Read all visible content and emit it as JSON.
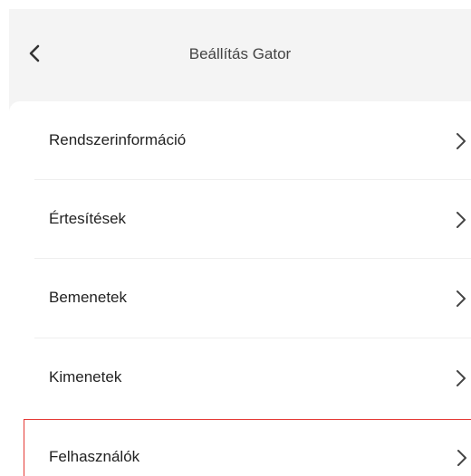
{
  "header": {
    "title": "Beállítás Gator",
    "back_icon": "chevron-left-icon"
  },
  "menu": {
    "items": [
      {
        "label": "Rendszerinformáció",
        "icon": "chevron-right-icon"
      },
      {
        "label": "Értesítések",
        "icon": "chevron-right-icon"
      },
      {
        "label": "Bemenetek",
        "icon": "chevron-right-icon"
      },
      {
        "label": "Kimenetek",
        "icon": "chevron-right-icon"
      },
      {
        "label": "Felhasználók",
        "icon": "chevron-right-icon",
        "selected": true
      }
    ]
  },
  "colors": {
    "background": "#f4f4f4",
    "card": "#ffffff",
    "highlight": "#e53935",
    "text": "#222222"
  }
}
